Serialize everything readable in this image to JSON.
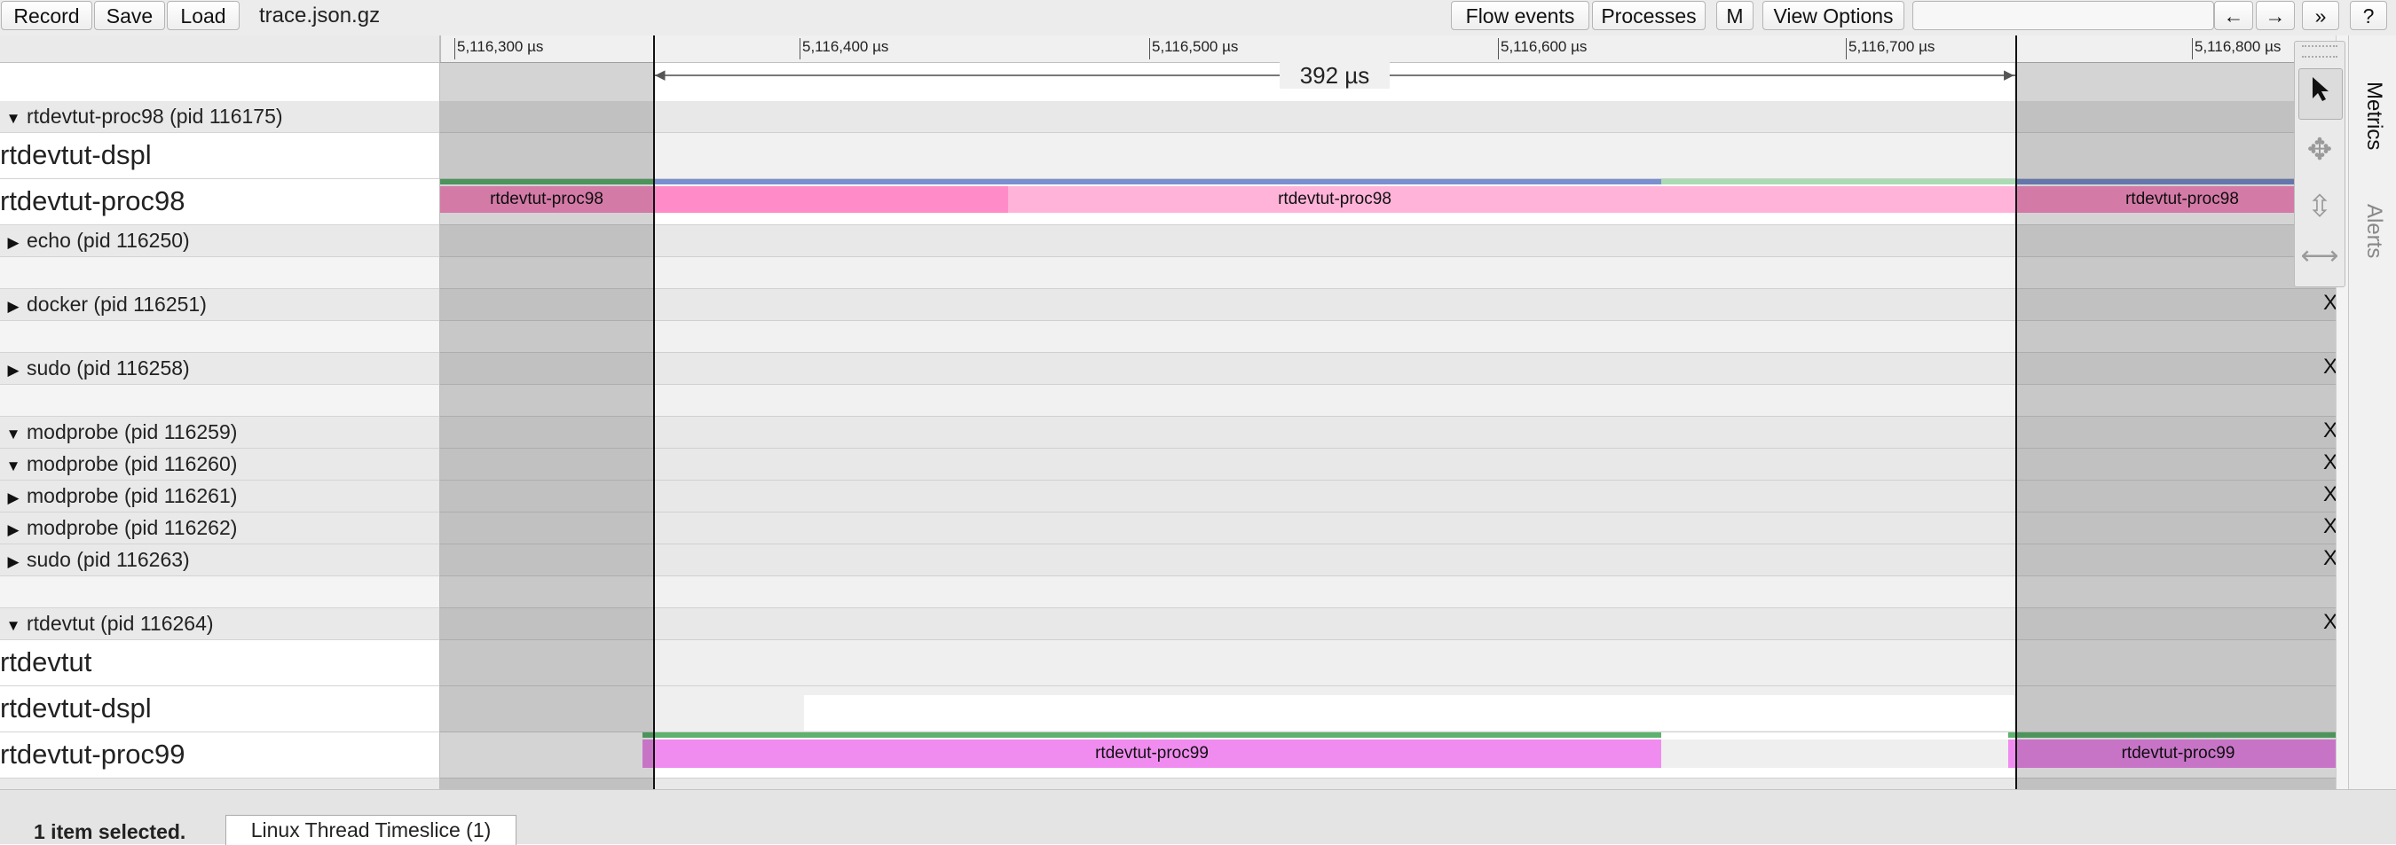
{
  "toolbar": {
    "record": "Record",
    "save": "Save",
    "load": "Load",
    "filename": "trace.json.gz",
    "flow_events": "Flow events",
    "processes": "Processes",
    "m": "M",
    "view_options": "View Options",
    "nav_back": "←",
    "nav_forward": "→",
    "nav_more": "»",
    "help": "?"
  },
  "ruler": {
    "ticks": [
      "5,116,300 µs",
      "5,116,400 µs",
      "5,116,500 µs",
      "5,116,600 µs",
      "5,116,700 µs",
      "5,116,800 µs"
    ],
    "selection_duration": "392 µs"
  },
  "processes": {
    "p98": {
      "label": "rtdevtut-proc98 (pid 116175)",
      "expanded": true,
      "threads": [
        "rtdevtut-dspl",
        "rtdevtut-proc98"
      ]
    },
    "echo": {
      "label": "echo (pid 116250)"
    },
    "docker": {
      "label": "docker (pid 116251)"
    },
    "sudo1": {
      "label": "sudo (pid 116258)"
    },
    "mp1": {
      "label": "modprobe (pid 116259)"
    },
    "mp2": {
      "label": "modprobe (pid 116260)"
    },
    "mp3": {
      "label": "modprobe (pid 116261)"
    },
    "mp4": {
      "label": "modprobe (pid 116262)"
    },
    "sudo2": {
      "label": "sudo (pid 116263)"
    },
    "rt": {
      "label": "rtdevtut (pid 116264)",
      "expanded": true,
      "threads": [
        "rtdevtut",
        "rtdevtut-dspl",
        "rtdevtut-proc99"
      ]
    }
  },
  "close_mark": "X",
  "slices": {
    "proc98": "rtdevtut-proc98",
    "proc99": "rtdevtut-proc99"
  },
  "side_tabs": {
    "metrics": "Metrics",
    "alerts": "Alerts"
  },
  "bottom": {
    "status": "1 item selected.",
    "tab": "Linux Thread Timeslice (1)"
  },
  "colors": {
    "proc98": "#ff93c9",
    "proc98_light": "#ffb3d9",
    "proc99": "#f08cf0",
    "green": "#5cb26e",
    "blue": "#7a8fd0"
  }
}
